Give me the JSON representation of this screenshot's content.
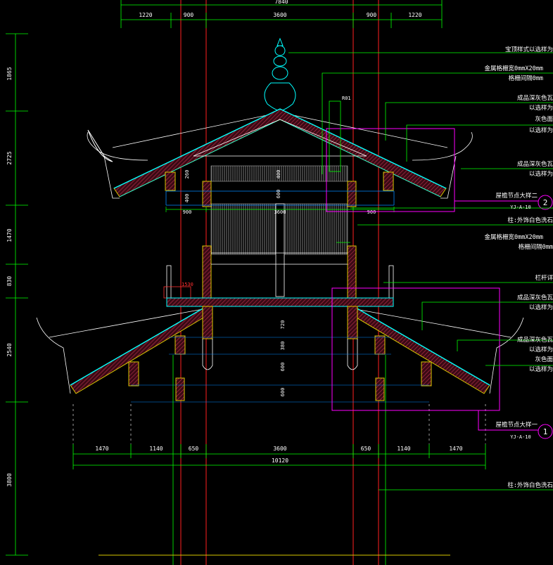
{
  "top_dims": [
    "1220",
    "900",
    "3600",
    "900",
    "1220"
  ],
  "top_total": "7840",
  "bottom_dims": [
    "1470",
    "1140",
    "650",
    "3600",
    "650",
    "1140",
    "1470"
  ],
  "bottom_total": "10120",
  "left_dims": [
    "1865",
    "2725",
    "1470",
    "830",
    "2540",
    "3800"
  ],
  "mid_dims": {
    "upper_v1": "260",
    "upper_v2": "400",
    "upper_v3": "400",
    "upper_v4": "600",
    "upper_h1": "900",
    "upper_h2": "3600",
    "upper_h3": "900",
    "lower_v1": "720",
    "lower_v2": "380",
    "lower_v3": "600",
    "lower_v4": "600",
    "railing": "1530",
    "ridge_tag": "R01"
  },
  "annotations": [
    "宝顶样式以选样为",
    "金属格栅宽0mmX20mm",
    "格栅间隔0mm",
    "成品深灰色瓦",
    "以选样为",
    "灰色面",
    "以选样为",
    "成品深灰色瓦",
    "以选样为",
    "屋檐节点大样二",
    "YJ-A-10",
    "柱:外饰白色洗石",
    "金属格栅宽0mmX20mm",
    "格栅间隔0mm",
    "栏杆详",
    "成品深灰色瓦",
    "以选样为",
    "成品深灰色瓦",
    "以选样为",
    "灰色面",
    "以选样为",
    "屋檐节点大样一",
    "YJ-A-10",
    "柱:外饰白色洗石"
  ],
  "callouts": [
    "2",
    "1"
  ],
  "colors": {
    "background": "#000000",
    "dim_line": "#00ff00",
    "axis": "#ff2020",
    "leader": "#00ff00",
    "structure": "#ffffff",
    "hatch": "#d8c800",
    "fill_hatch": "#b02040",
    "roof_edge": "#00ffff",
    "detail_frame": "#ff00ff",
    "guide": "#0088ff"
  }
}
